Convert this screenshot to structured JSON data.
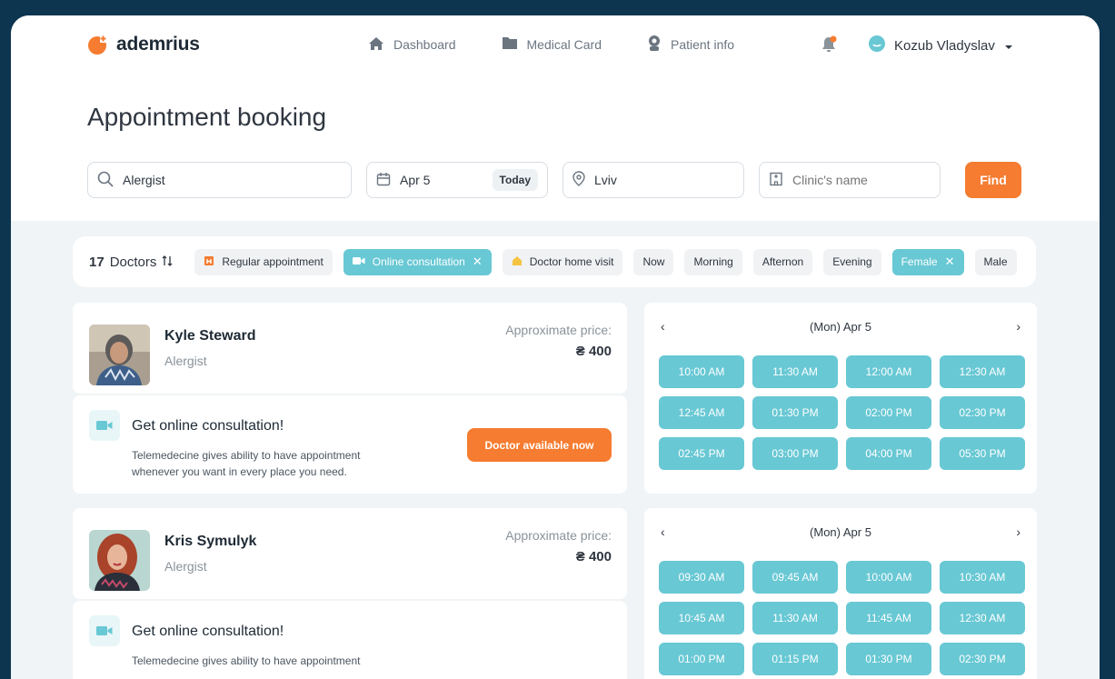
{
  "app": {
    "brand": "ademrius"
  },
  "nav": [
    {
      "label": "Dashboard",
      "icon": "home-icon"
    },
    {
      "label": "Medical Card",
      "icon": "folder-icon"
    },
    {
      "label": "Patient info",
      "icon": "person-icon"
    }
  ],
  "user": {
    "name": "Kozub Vladyslav"
  },
  "page": {
    "title": "Appointment booking"
  },
  "search": {
    "specialty": "Alergist",
    "date": "Apr 5",
    "today_label": "Today",
    "city": "Lviv",
    "clinic_placeholder": "Clinic's name",
    "find_label": "Find"
  },
  "filters": {
    "count_number": "17",
    "count_label": "Doctors",
    "chips": [
      {
        "label": "Regular appointment",
        "active": false
      },
      {
        "label": "Online consultation",
        "active": true
      },
      {
        "label": "Doctor home visit",
        "active": false
      },
      {
        "label": "Now",
        "active": false
      },
      {
        "label": "Morning",
        "active": false
      },
      {
        "label": "Afternon",
        "active": false
      },
      {
        "label": "Evening",
        "active": false
      },
      {
        "label": "Female",
        "active": true
      },
      {
        "label": "Male",
        "active": false
      }
    ]
  },
  "doctors": [
    {
      "name": "Kyle Steward",
      "specialty": "Alergist",
      "price_label": "Approximate price:",
      "price": "₴ 400",
      "promo_title": "Get online consultation!",
      "promo_text": "Telemedecine gives ability to have appointment whenever you want in every place you need.",
      "promo_button": "Doctor available now",
      "schedule_date": "(Mon) Apr 5",
      "slots": [
        "10:00 AM",
        "11:30 AM",
        "12:00 AM",
        "12:30 AM",
        "12:45 AM",
        "01:30 PM",
        "02:00 PM",
        "02:30 PM",
        "02:45 PM",
        "03:00 PM",
        "04:00 PM",
        "05:30 PM"
      ]
    },
    {
      "name": "Kris Symulyk",
      "specialty": "Alergist",
      "price_label": "Approximate price:",
      "price": "₴ 400",
      "promo_title": "Get online consultation!",
      "promo_text": "Telemedecine gives ability to have appointment",
      "schedule_date": "(Mon) Apr 5",
      "slots": [
        "09:30 AM",
        "09:45 AM",
        "10:00 AM",
        "10:30 AM",
        "10:45 AM",
        "11:30 AM",
        "11:45 AM",
        "12:30 AM",
        "01:00 PM",
        "01:15 PM",
        "01:30 PM",
        "02:30 PM"
      ]
    }
  ],
  "colors": {
    "accent": "#f57c30",
    "slot": "#68c8d4",
    "frame": "#0d3550"
  }
}
